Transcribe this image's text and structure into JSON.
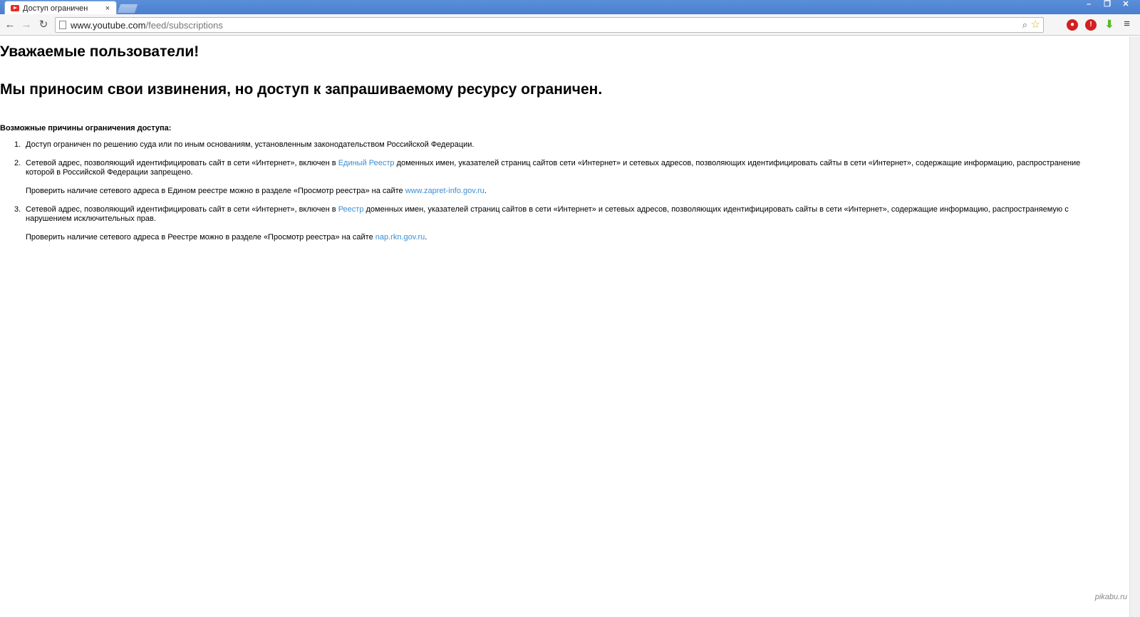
{
  "browser": {
    "tab_title": "Доступ ограничен",
    "tab_close": "×",
    "url_host": "www.youtube.com",
    "url_path": "/feed/subscriptions"
  },
  "page": {
    "heading": "Уважаемые пользователи!",
    "subheading": "Мы приносим свои извинения, но доступ к запрашиваемому ресурсу ограничен.",
    "reasons_title": "Возможные причины ограничения доступа:",
    "reasons": [
      {
        "number": "1.",
        "text": "Доступ ограничен  по решению суда или по иным основаниям, установленным законодательством Российской Федерации."
      },
      {
        "number": "2.",
        "text_before": "Сетевой адрес, позволяющий идентифицировать сайт в сети «Интернет», включен в ",
        "link": "Единый Реестр",
        "text_after": " доменных имен, указателей страниц сайтов сети «Интернет» и сетевых адресов, позволяющих идентифицировать сайты в сети «Интернет», содержащие информацию, распространение которой в Российской Федерации запрещено.",
        "check_text": "Проверить наличие сетевого адреса в Едином реестре можно в разделе «Просмотр реестра» на сайте ",
        "check_link": "www.zapret-info.gov.ru",
        "check_end": "."
      },
      {
        "number": "3.",
        "text_before": "Сетевой адрес, позволяющий идентифицировать сайт в сети «Интернет», включен в ",
        "link": "Реестр",
        "text_after": " доменных имен, указателей страниц сайтов в сети «Интернет» и сетевых адресов, позволяющих идентифицировать сайты в сети «Интернет», содержащие информацию, распространяемую с нарушением исключительных прав.",
        "check_text": "Проверить наличие сетевого адреса в Реестре можно в разделе «Просмотр реестра» на сайте ",
        "check_link": "nap.rkn.gov.ru",
        "check_end": "."
      }
    ]
  },
  "watermark": "pikabu.ru",
  "colors": {
    "link": "#3a8ed4",
    "titlebar": "#4a7fd0"
  }
}
